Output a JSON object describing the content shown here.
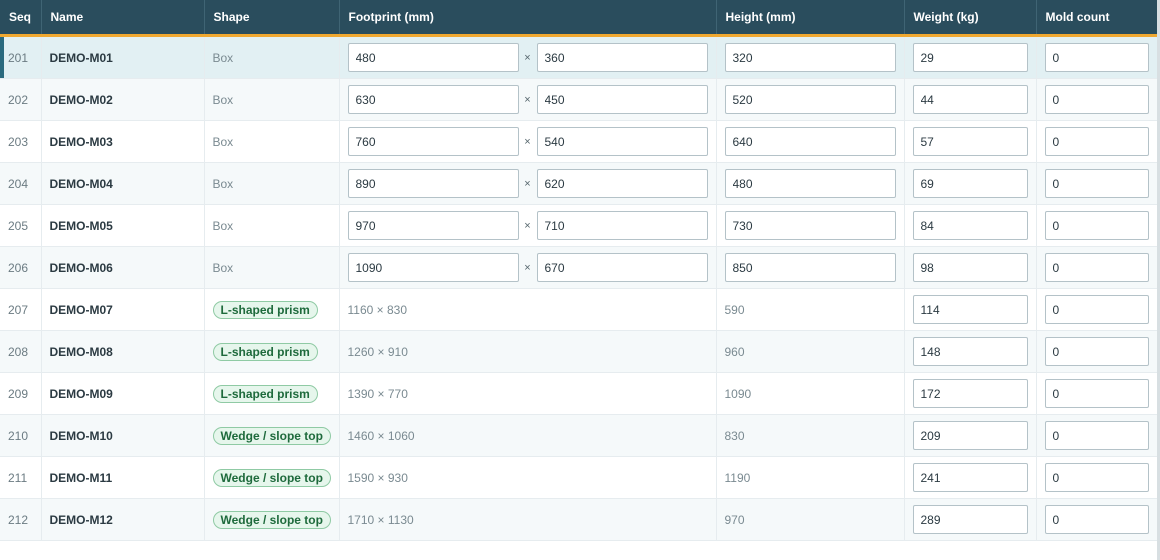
{
  "columns": {
    "seq": "Seq",
    "name": "Name",
    "shape": "Shape",
    "footprint": "Footprint (mm)",
    "height": "Height (mm)",
    "weight": "Weight (kg)",
    "mold_count": "Mold count"
  },
  "footprint_separator": "×",
  "accent_colors": {
    "header_bg": "#2a4d5d",
    "header_underline": "#f0a830",
    "selected_row": "#e2f0f3",
    "badge_green": "#1e6a3c"
  },
  "rows": [
    {
      "seq": "201",
      "name": "DEMO-M01",
      "shape": "Box",
      "editable": true,
      "fp_w": "480",
      "fp_d": "360",
      "height": "320",
      "weight": "29",
      "mold": "0",
      "selected": true
    },
    {
      "seq": "202",
      "name": "DEMO-M02",
      "shape": "Box",
      "editable": true,
      "fp_w": "630",
      "fp_d": "450",
      "height": "520",
      "weight": "44",
      "mold": "0"
    },
    {
      "seq": "203",
      "name": "DEMO-M03",
      "shape": "Box",
      "editable": true,
      "fp_w": "760",
      "fp_d": "540",
      "height": "640",
      "weight": "57",
      "mold": "0"
    },
    {
      "seq": "204",
      "name": "DEMO-M04",
      "shape": "Box",
      "editable": true,
      "fp_w": "890",
      "fp_d": "620",
      "height": "480",
      "weight": "69",
      "mold": "0"
    },
    {
      "seq": "205",
      "name": "DEMO-M05",
      "shape": "Box",
      "editable": true,
      "fp_w": "970",
      "fp_d": "710",
      "height": "730",
      "weight": "84",
      "mold": "0"
    },
    {
      "seq": "206",
      "name": "DEMO-M06",
      "shape": "Box",
      "editable": true,
      "fp_w": "1090",
      "fp_d": "670",
      "height": "850",
      "weight": "98",
      "mold": "0"
    },
    {
      "seq": "207",
      "name": "DEMO-M07",
      "shape": "L-shaped prism",
      "editable": false,
      "footprint_text": "1160 × 830",
      "height": "590",
      "weight": "114",
      "mold": "0"
    },
    {
      "seq": "208",
      "name": "DEMO-M08",
      "shape": "L-shaped prism",
      "editable": false,
      "footprint_text": "1260 × 910",
      "height": "960",
      "weight": "148",
      "mold": "0"
    },
    {
      "seq": "209",
      "name": "DEMO-M09",
      "shape": "L-shaped prism",
      "editable": false,
      "footprint_text": "1390 × 770",
      "height": "1090",
      "weight": "172",
      "mold": "0"
    },
    {
      "seq": "210",
      "name": "DEMO-M10",
      "shape": "Wedge / slope top",
      "editable": false,
      "footprint_text": "1460 × 1060",
      "height": "830",
      "weight": "209",
      "mold": "0"
    },
    {
      "seq": "211",
      "name": "DEMO-M11",
      "shape": "Wedge / slope top",
      "editable": false,
      "footprint_text": "1590 × 930",
      "height": "1190",
      "weight": "241",
      "mold": "0"
    },
    {
      "seq": "212",
      "name": "DEMO-M12",
      "shape": "Wedge / slope top",
      "editable": false,
      "footprint_text": "1710 × 1130",
      "height": "970",
      "weight": "289",
      "mold": "0"
    }
  ]
}
